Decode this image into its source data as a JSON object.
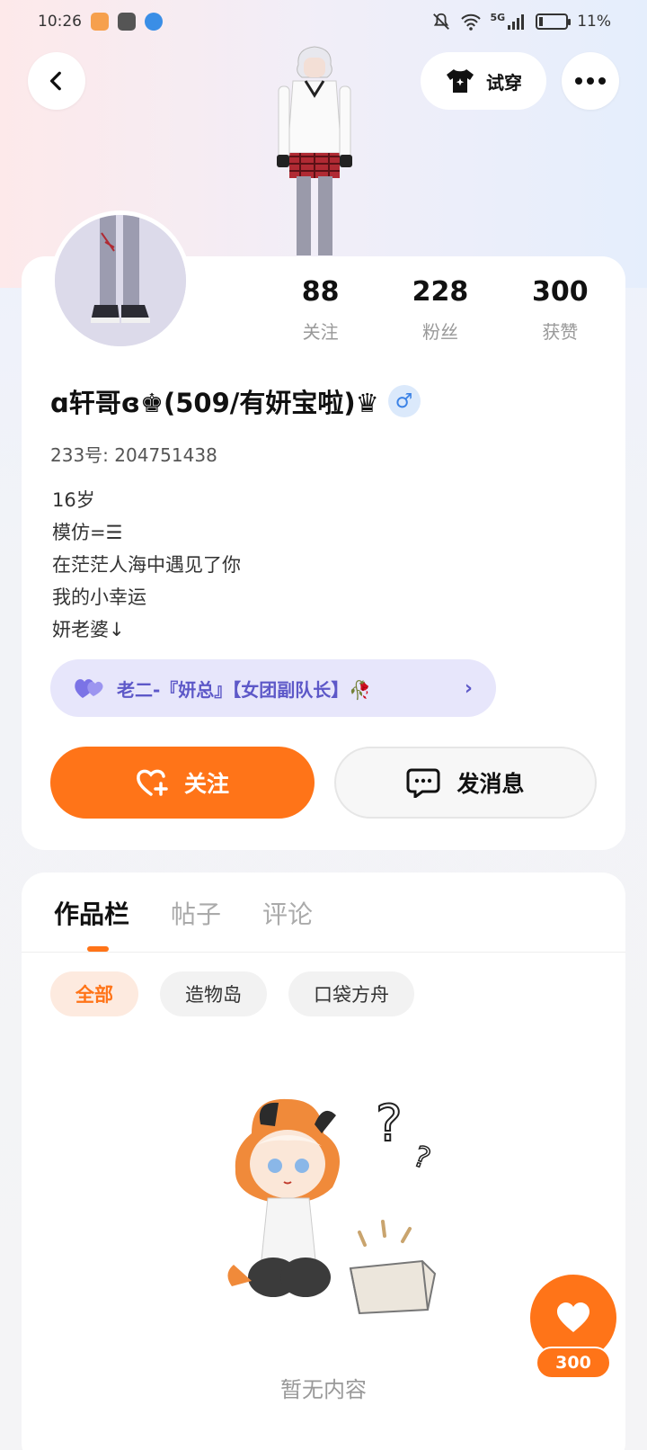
{
  "status_bar": {
    "time": "10:26",
    "network": "5G",
    "battery": "11%"
  },
  "header": {
    "try_on_label": "试穿"
  },
  "stats": [
    {
      "value": "88",
      "label": "关注"
    },
    {
      "value": "228",
      "label": "粉丝"
    },
    {
      "value": "300",
      "label": "获赞"
    }
  ],
  "profile": {
    "nickname": "ɑ轩哥ɞ♚(509/有妍宝啦)♛",
    "gender_symbol": "♂",
    "user_id": "233号: 204751438",
    "bio_lines": [
      "16岁",
      "模仿=☰",
      "在茫茫人海中遇见了你",
      "我的小幸运",
      "妍老婆↓"
    ],
    "relation": "老二-『妍总』【女团副队长】🥀"
  },
  "actions": {
    "follow_label": "关注",
    "message_label": "发消息"
  },
  "tabs": [
    "作品栏",
    "帖子",
    "评论"
  ],
  "chips": [
    "全部",
    "造物岛",
    "口袋方舟"
  ],
  "empty_state": {
    "text": "暂无内容"
  },
  "like": {
    "count": "300"
  },
  "colors": {
    "accent": "#ff7418",
    "relation_text": "#5d58c8",
    "relation_bg": "#e7e6fb"
  }
}
